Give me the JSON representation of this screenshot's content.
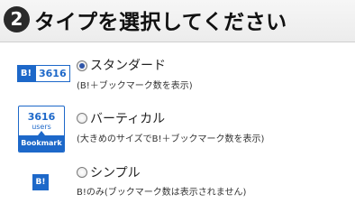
{
  "header": {
    "step_number": "2",
    "title": "タイプを選択してください"
  },
  "options": [
    {
      "label": "スタンダード",
      "description": "(B!＋ブックマーク数を表示)",
      "checked": true,
      "badge": {
        "logo": "B!",
        "count": "3616"
      }
    },
    {
      "label": "バーティカル",
      "description": "(大きめのサイズでB!＋ブックマーク数を表示)",
      "checked": false,
      "badge": {
        "count": "3616",
        "unit": "users",
        "footer": "Bookmark"
      }
    },
    {
      "label": "シンプル",
      "description": "B!のみ(ブックマーク数は表示されません)",
      "checked": false,
      "badge": {
        "logo": "B!"
      }
    }
  ],
  "colors": {
    "badge_blue": "#1d68c9",
    "header_bg": "#efefef"
  }
}
